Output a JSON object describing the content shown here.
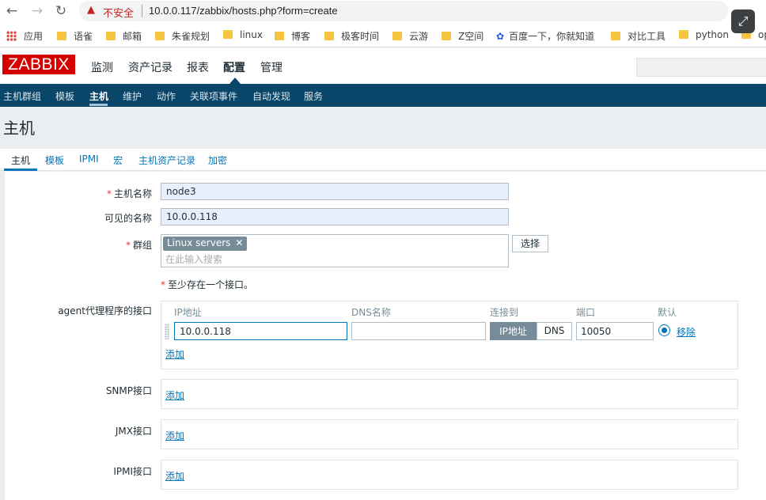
{
  "browser": {
    "insecure_label": "不安全",
    "url": "10.0.0.117/zabbix/hosts.php?form=create",
    "bookmarks": [
      "应用",
      "语雀",
      "邮箱",
      "朱雀规划",
      "linux",
      "博客",
      "极客时间",
      "云游",
      "Z空间",
      "百度一下，你就知道",
      "对比工具",
      "python",
      "op"
    ]
  },
  "zabbix": {
    "logo": "ZABBIX",
    "main_menu": [
      "监测",
      "资产记录",
      "报表",
      "配置",
      "管理"
    ],
    "sub_menu": [
      "主机群组",
      "模板",
      "主机",
      "维护",
      "动作",
      "关联项事件",
      "自动发现",
      "服务"
    ]
  },
  "page": {
    "title": "主机",
    "tabs": [
      "主机",
      "模板",
      "IPMI",
      "宏",
      "主机资产记录",
      "加密"
    ]
  },
  "form": {
    "host_name_label": "主机名称",
    "host_name_value": "node3",
    "visible_name_label": "可见的名称",
    "visible_name_value": "10.0.0.118",
    "groups_label": "群组",
    "group_tag": "Linux servers",
    "group_placeholder": "在此输入搜索",
    "select_button": "选择",
    "interface_note": "至少存在一个接口。",
    "agent_label": "agent代理程序的接口",
    "columns": [
      "IP地址",
      "DNS名称",
      "连接到",
      "端口",
      "默认"
    ],
    "agent_ip": "10.0.0.118",
    "agent_dns": "",
    "connect_ip": "IP地址",
    "connect_dns": "DNS",
    "agent_port": "10050",
    "remove_link": "移除",
    "add_link": "添加",
    "snmp_label": "SNMP接口",
    "jmx_label": "JMX接口",
    "ipmi_label": "IPMI接口"
  },
  "colors": {
    "zabbix_red": "#d40000",
    "subnav_bg": "#0a466a",
    "link_blue": "#0275b8"
  }
}
